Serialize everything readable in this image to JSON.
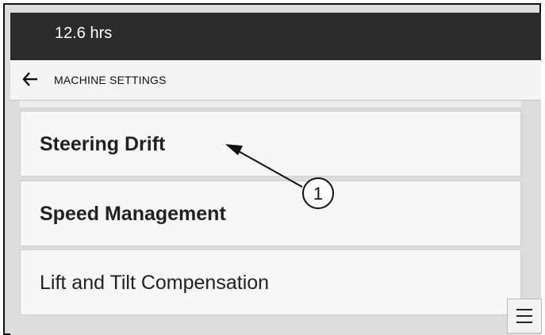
{
  "status_bar": {
    "hours": "12.6 hrs"
  },
  "nav": {
    "title": "MACHINE SETTINGS",
    "back_icon": "back-arrow-icon"
  },
  "menu": [
    {
      "label": "Steering Drift"
    },
    {
      "label": "Speed Management"
    },
    {
      "label": "Lift and Tilt Compensation"
    }
  ],
  "callout": {
    "number": "1"
  },
  "menu_button": {
    "icon": "hamburger-menu-icon"
  },
  "colors": {
    "status_bar": "#2b2b2b",
    "nav_bar": "#f4f4f4",
    "list_bg": "#dcdcdc",
    "item_bg": "#f7f7f7"
  }
}
